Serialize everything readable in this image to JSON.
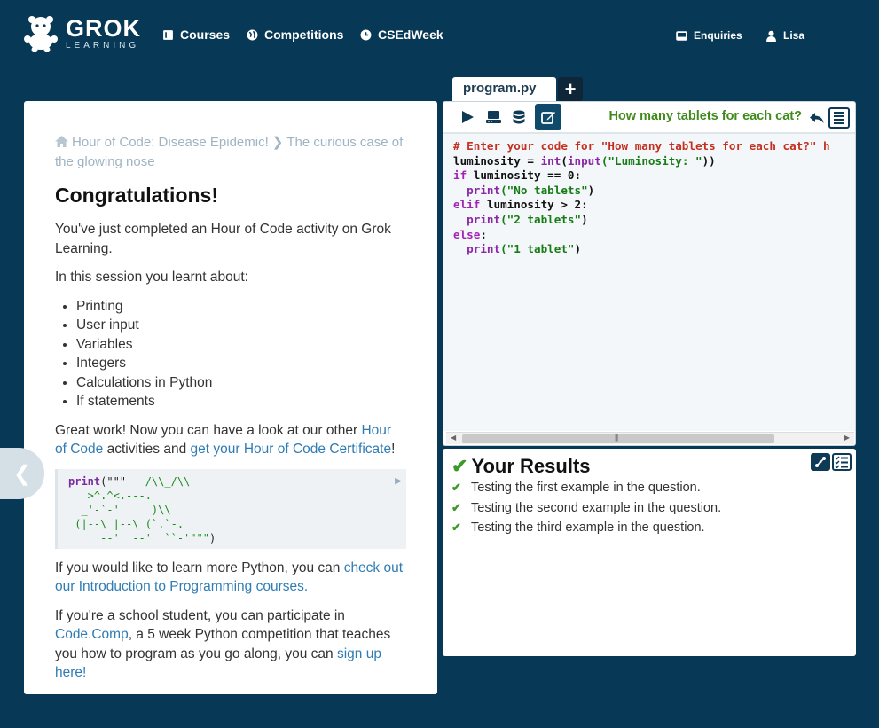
{
  "nav": {
    "logo_main": "GROK",
    "logo_sub": "LEARNING",
    "courses": "Courses",
    "competitions": "Competitions",
    "csedweek": "CSEdWeek",
    "enquiries": "Enquiries",
    "user": "Lisa"
  },
  "lesson": {
    "breadcrumb_part1": "Hour of Code: Disease Epidemic!",
    "breadcrumb_part2": "The curious case of the glowing nose",
    "heading": "Congratulations!",
    "intro": "You've just completed an Hour of Code activity on Grok Learning.",
    "session_intro": "In this session you learnt about:",
    "topics": [
      "Printing",
      "User input",
      "Variables",
      "Integers",
      "Calculations in Python",
      "If statements"
    ],
    "great_work_pre": "Great work! Now you can have a look at our other ",
    "hour_of_code_link": "Hour of Code",
    "great_work_mid": " activities and ",
    "certificate_link": "get your Hour of Code Certificate",
    "great_work_post": "!",
    "code_print": "print",
    "code_open": "(\"\"\"",
    "code_art": "   /\\\\_/\\\\\n   >^.^<.---.\n  _'-`-'     )\\\\\n (|--\\ |--\\ (`.`-.\n     --'  --'  ``-'\"\"\"",
    "code_close": ")",
    "learn_more_pre": "If you would like to learn more Python, you can ",
    "learn_more_link": "check out our Introduction to Programming courses.",
    "student_pre": "If you're a school student, you can participate in ",
    "codecomp_link": "Code.Comp",
    "student_mid": ", a 5 week Python competition that teaches you how to program as you go along, you can ",
    "signup_link": "sign up here!"
  },
  "editor": {
    "file_tab": "program.py",
    "add_tab": "+",
    "question_title": "How many tablets for each cat?",
    "code": {
      "l1_comment": "# Enter your code for \"How many tablets for each cat?\" h",
      "l2_var": "luminosity = ",
      "l2_int": "int",
      "l2_paren": "(",
      "l2_input": "input",
      "l2_str": "(\"Luminosity: \"",
      "l2_end": "))",
      "l3_kw": "if",
      "l3_rest": " luminosity == 0:",
      "l4_indent": "  ",
      "l4_fn": "print",
      "l4_str": "(\"No tablets\"",
      "l4_end": ")",
      "l5_kw": "elif",
      "l5_rest": " luminosity > 2:",
      "l6_fn": "print",
      "l6_str": "(\"2 tablets\"",
      "l6_end": ")",
      "l7_kw": "else",
      "l7_rest": ":",
      "l8_fn": "print",
      "l8_str": "(\"1 tablet\"",
      "l8_end": ")"
    }
  },
  "results": {
    "title": "Your Results",
    "items": [
      "Testing the first example in the question.",
      "Testing the second example in the question.",
      "Testing the third example in the question."
    ]
  },
  "colors": {
    "background": "#073855",
    "accent_green": "#3f8a1a",
    "link_blue": "#2f7cb4",
    "active_button": "#0f4a6b"
  }
}
